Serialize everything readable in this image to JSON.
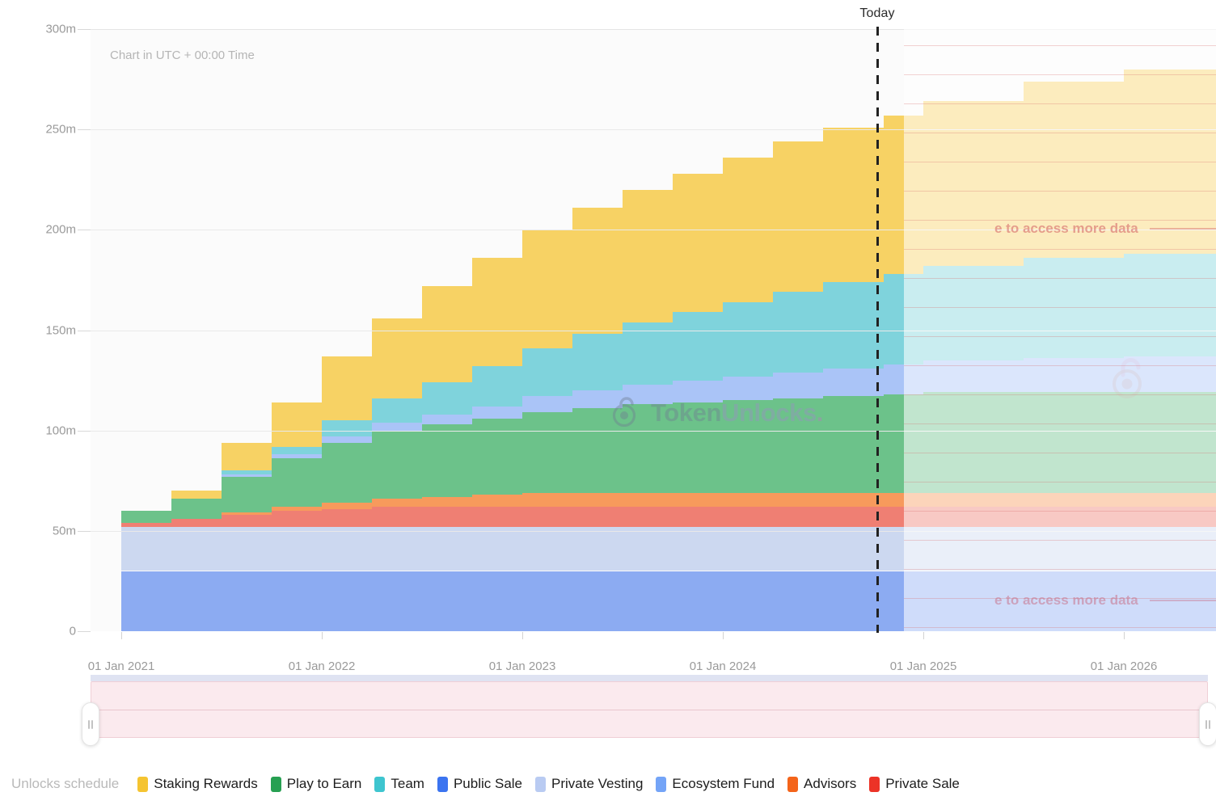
{
  "chart_note": "Chart in UTC + 00:00 Time",
  "today_label": "Today",
  "legend_title": "Unlocks schedule",
  "axes": {
    "y_ticks": [
      "0",
      "50m",
      "100m",
      "150m",
      "200m",
      "250m",
      "300m"
    ],
    "x_ticks": [
      "01 Jan 2021",
      "01 Jan 2022",
      "01 Jan 2023",
      "01 Jan 2024",
      "01 Jan 2025",
      "01 Jan 2026"
    ]
  },
  "watermark": {
    "part_a": "Token",
    "part_b": "Unlocks",
    "dot": ".",
    "lock_icon": "unlocked-padlock-icon"
  },
  "paywall": {
    "message": "e to access more data",
    "crown_icon": "crown-icon",
    "positions": [
      "upper",
      "lower"
    ]
  },
  "slider": {
    "left_handle": "range-handle-left",
    "right_handle": "range-handle-right",
    "grip": "range-drag-grip"
  },
  "chart_data": {
    "type": "area",
    "title": "",
    "subtitle": "Chart in UTC + 00:00 Time",
    "xlabel": "",
    "ylabel": "",
    "ylim": [
      0,
      300000000
    ],
    "ytick_values": [
      0,
      50000000,
      100000000,
      150000000,
      200000000,
      250000000,
      300000000
    ],
    "ytick_labels": [
      "0",
      "50m",
      "100m",
      "150m",
      "200m",
      "250m",
      "300m"
    ],
    "grid": true,
    "legend_position": "bottom",
    "stacked": true,
    "stack_order_bottom_to_top": [
      "Public Sale",
      "Private Vesting",
      "Private Sale",
      "Advisors",
      "Play to Earn",
      "Ecosystem Fund",
      "Team",
      "Staking Rewards"
    ],
    "today_marker_x": "2024-10-20",
    "locked_region_start_x": "2025-01-01",
    "x": [
      "2021-01-01",
      "2021-04-01",
      "2021-07-01",
      "2021-10-01",
      "2022-01-01",
      "2022-04-01",
      "2022-07-01",
      "2022-10-01",
      "2023-01-01",
      "2023-04-01",
      "2023-07-01",
      "2023-10-01",
      "2024-01-01",
      "2024-04-01",
      "2024-07-01",
      "2024-10-20",
      "2025-01-01",
      "2025-07-01",
      "2026-01-01",
      "2026-07-01"
    ],
    "x_tick_labels": [
      "01 Jan 2021",
      "01 Jan 2022",
      "01 Jan 2023",
      "01 Jan 2024",
      "01 Jan 2025",
      "01 Jan 2026"
    ],
    "series": [
      {
        "name": "Public Sale",
        "color": "#8cabf2",
        "values": [
          30,
          30,
          30,
          30,
          30,
          30,
          30,
          30,
          30,
          30,
          30,
          30,
          30,
          30,
          30,
          30,
          30,
          30,
          30,
          30
        ]
      },
      {
        "name": "Private Vesting",
        "color": "#ccd8f0",
        "values": [
          22,
          22,
          22,
          22,
          22,
          22,
          22,
          22,
          22,
          22,
          22,
          22,
          22,
          22,
          22,
          22,
          22,
          22,
          22,
          22
        ]
      },
      {
        "name": "Private Sale",
        "color": "#ef7f73",
        "values": [
          2,
          4,
          6,
          8,
          9,
          10,
          10,
          10,
          10,
          10,
          10,
          10,
          10,
          10,
          10,
          10,
          10,
          10,
          10,
          10
        ]
      },
      {
        "name": "Advisors",
        "color": "#f79a5c",
        "values": [
          0,
          0,
          1,
          2,
          3,
          4,
          5,
          6,
          7,
          7,
          7,
          7,
          7,
          7,
          7,
          7,
          7,
          7,
          7,
          7
        ]
      },
      {
        "name": "Play to Earn",
        "color": "#6cc28a",
        "values": [
          6,
          10,
          18,
          24,
          30,
          34,
          36,
          38,
          40,
          42,
          44,
          45,
          46,
          47,
          48,
          49,
          50,
          50,
          50,
          50
        ]
      },
      {
        "name": "Ecosystem Fund",
        "color": "#aac4f7",
        "values": [
          0,
          0,
          1,
          2,
          3,
          4,
          5,
          6,
          8,
          9,
          10,
          11,
          12,
          13,
          14,
          15,
          16,
          17,
          18,
          18
        ]
      },
      {
        "name": "Team",
        "color": "#7fd3dc",
        "values": [
          0,
          0,
          2,
          4,
          8,
          12,
          16,
          20,
          24,
          28,
          31,
          34,
          37,
          40,
          43,
          45,
          47,
          50,
          51,
          51
        ]
      },
      {
        "name": "Staking Rewards",
        "color": "#f7d264",
        "values": [
          0,
          4,
          14,
          22,
          32,
          40,
          48,
          54,
          59,
          63,
          66,
          69,
          72,
          75,
          77,
          79,
          82,
          88,
          92,
          95
        ]
      }
    ],
    "total_at_today": 250,
    "total_at_end": 270
  },
  "legend": [
    {
      "label": "Staking Rewards",
      "color": "#f5c431"
    },
    {
      "label": "Play to Earn",
      "color": "#27a052"
    },
    {
      "label": "Team",
      "color": "#3ec5cf"
    },
    {
      "label": "Public Sale",
      "color": "#3b74f0"
    },
    {
      "label": "Private Vesting",
      "color": "#b9cbf2"
    },
    {
      "label": "Ecosystem Fund",
      "color": "#74a4f7"
    },
    {
      "label": "Advisors",
      "color": "#f4641a"
    },
    {
      "label": "Private Sale",
      "color": "#ec3327"
    }
  ]
}
